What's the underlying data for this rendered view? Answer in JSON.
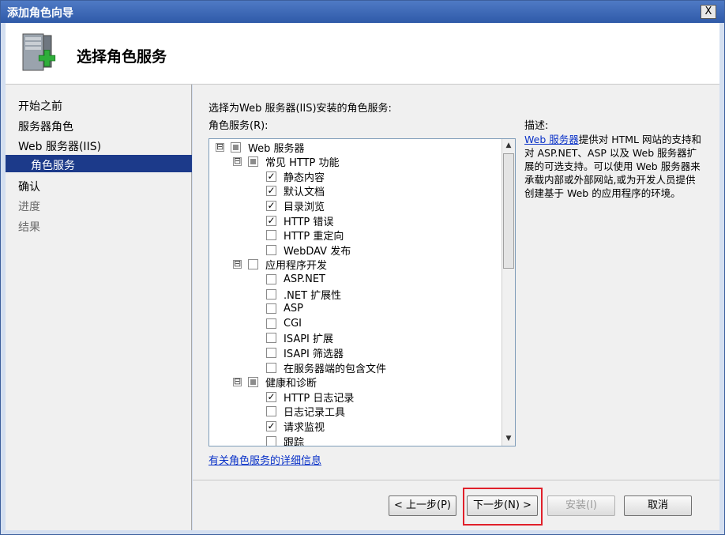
{
  "window": {
    "title": "添加角色向导",
    "close_label": "X"
  },
  "header": {
    "title": "选择角色服务",
    "icon": "server-add-icon"
  },
  "nav": {
    "items": [
      {
        "label": "开始之前",
        "state": "normal"
      },
      {
        "label": "服务器角色",
        "state": "normal"
      },
      {
        "label": "Web 服务器(IIS)",
        "state": "normal"
      },
      {
        "label": "角色服务",
        "state": "active"
      },
      {
        "label": "确认",
        "state": "normal"
      },
      {
        "label": "进度",
        "state": "dim"
      },
      {
        "label": "结果",
        "state": "dim"
      }
    ]
  },
  "main": {
    "instruction": "选择为Web 服务器(IIS)安装的角色服务:",
    "roles_label": "角色服务(R):",
    "tree": [
      {
        "label": "Web 服务器",
        "state": "partial",
        "expander": "⊟",
        "level": 0
      },
      {
        "label": "常见 HTTP 功能",
        "state": "partial",
        "expander": "⊟",
        "level": 1
      },
      {
        "label": "静态内容",
        "state": "checked",
        "level": 2
      },
      {
        "label": "默认文档",
        "state": "checked",
        "level": 2
      },
      {
        "label": "目录浏览",
        "state": "checked",
        "level": 2
      },
      {
        "label": "HTTP 错误",
        "state": "checked",
        "level": 2
      },
      {
        "label": "HTTP 重定向",
        "state": "unchecked",
        "level": 2
      },
      {
        "label": "WebDAV 发布",
        "state": "unchecked",
        "level": 2
      },
      {
        "label": "应用程序开发",
        "state": "unchecked",
        "expander": "⊟",
        "level": 1
      },
      {
        "label": "ASP.NET",
        "state": "unchecked",
        "level": 2
      },
      {
        "label": ".NET 扩展性",
        "state": "unchecked",
        "level": 2
      },
      {
        "label": "ASP",
        "state": "unchecked",
        "level": 2
      },
      {
        "label": "CGI",
        "state": "unchecked",
        "level": 2
      },
      {
        "label": "ISAPI 扩展",
        "state": "unchecked",
        "level": 2
      },
      {
        "label": "ISAPI 筛选器",
        "state": "unchecked",
        "level": 2
      },
      {
        "label": "在服务器端的包含文件",
        "state": "unchecked",
        "level": 2
      },
      {
        "label": "健康和诊断",
        "state": "partial",
        "expander": "⊟",
        "level": 1
      },
      {
        "label": "HTTP 日志记录",
        "state": "checked",
        "level": 2
      },
      {
        "label": "日志记录工具",
        "state": "unchecked",
        "level": 2
      },
      {
        "label": "请求监视",
        "state": "checked",
        "level": 2
      },
      {
        "label": "跟踪",
        "state": "unchecked",
        "level": 2
      }
    ],
    "more_info_link": "有关角色服务的详细信息",
    "description": {
      "label": "描述:",
      "link": "Web 服务器",
      "text": "提供对 HTML 网站的支持和对 ASP.NET、ASP 以及 Web 服务器扩展的可选支持。可以使用 Web 服务器来承载内部或外部网站,或为开发人员提供创建基于 Web 的应用程序的环境。"
    }
  },
  "buttons": {
    "prev": "< 上一步(P)",
    "next": "下一步(N) >",
    "install": "安装(I)",
    "cancel": "取消"
  },
  "colors": {
    "accent": "#1c3a8a",
    "highlight": "#e0202a",
    "link": "#0a32c8"
  }
}
